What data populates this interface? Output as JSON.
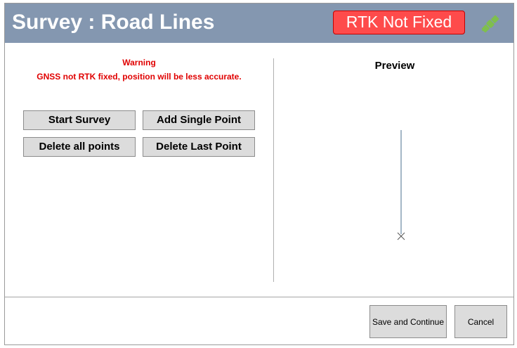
{
  "header": {
    "title": "Survey : Road Lines",
    "rtk_status": "RTK Not Fixed",
    "status_icon": "satellite-icon",
    "colors": {
      "header_bg": "#8497b0",
      "badge_bg": "#fe4b4b",
      "icon_green": "#7fbf4d"
    }
  },
  "warning": {
    "title": "Warning",
    "message": "GNSS not RTK fixed, position will be less accurate.",
    "color": "#e00000"
  },
  "actions": {
    "start_survey": "Start Survey",
    "add_single_point": "Add Single Point",
    "delete_all_points": "Delete all points",
    "delete_last_point": "Delete Last Point"
  },
  "preview": {
    "title": "Preview",
    "line_color": "#4a6f8f"
  },
  "footer": {
    "save_continue": "Save and Continue",
    "cancel": "Cancel"
  }
}
